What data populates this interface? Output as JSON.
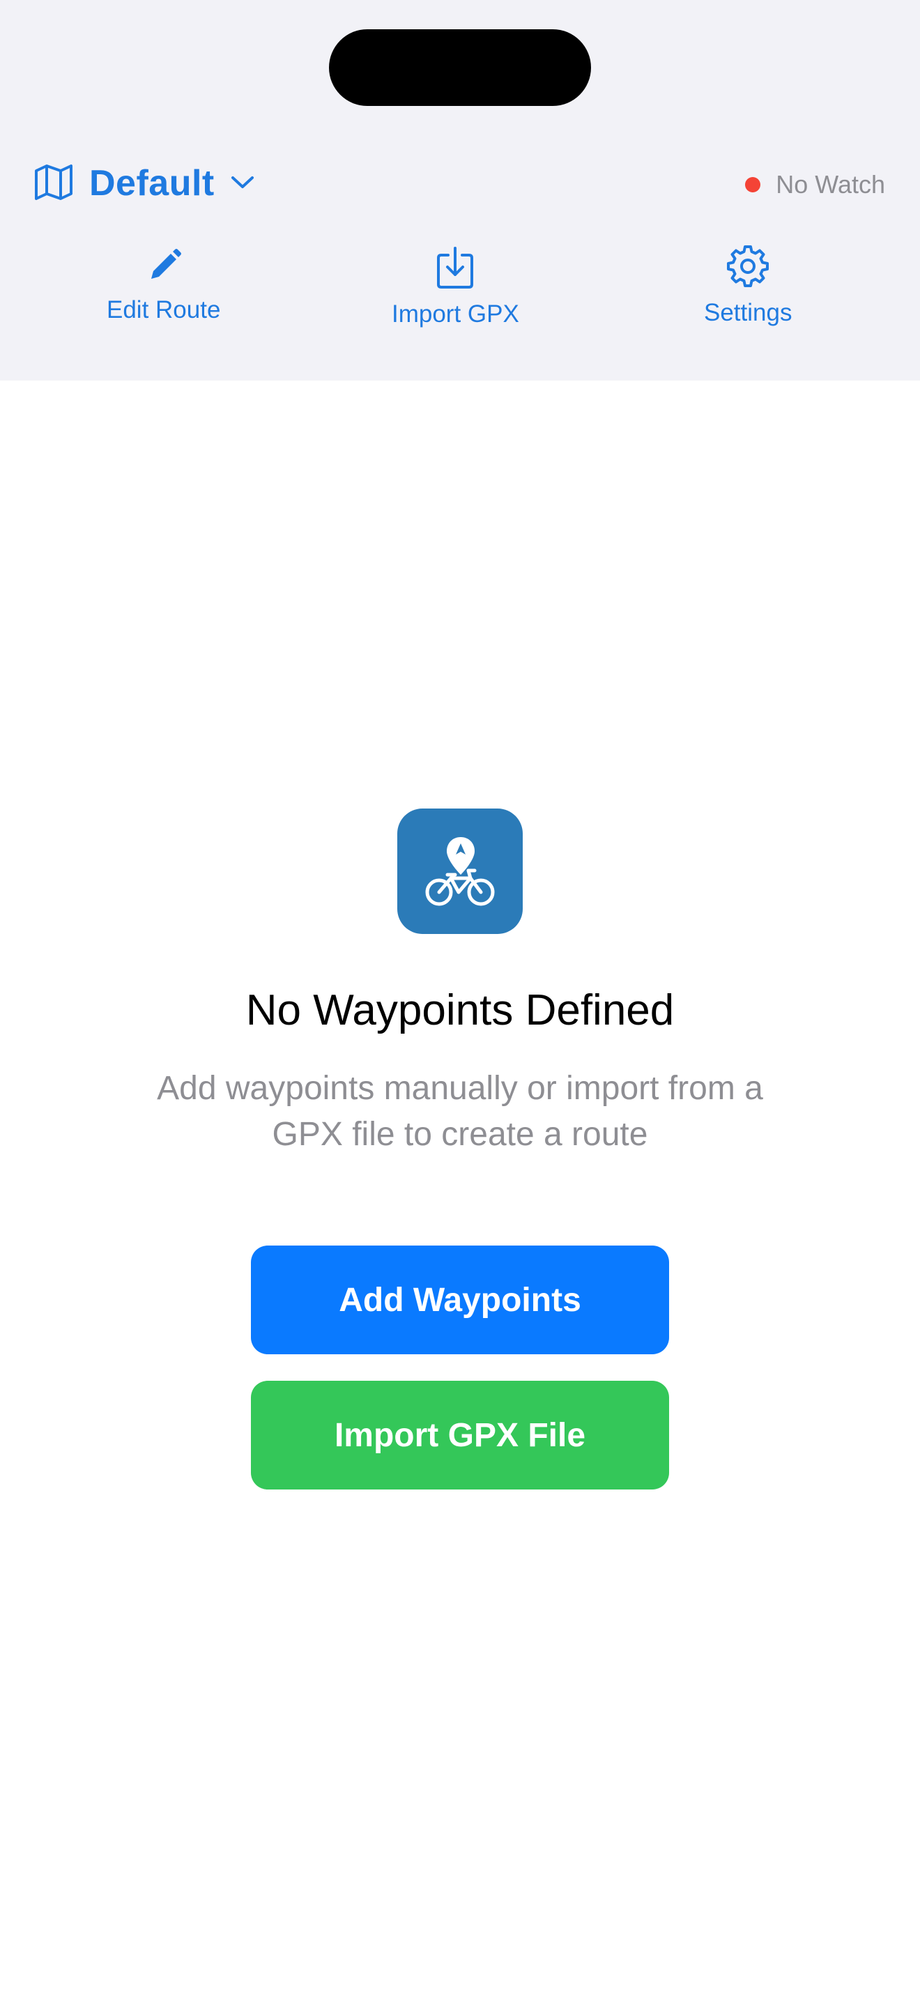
{
  "header": {
    "route_name": "Default",
    "watch_status": "No Watch",
    "toolbar": {
      "edit_route": "Edit Route",
      "import_gpx": "Import GPX",
      "settings": "Settings"
    }
  },
  "empty_state": {
    "title": "No Waypoints Defined",
    "description": "Add waypoints manually or import from a GPX file to create a route",
    "add_waypoints_button": "Add Waypoints",
    "import_gpx_file_button": "Import GPX File"
  },
  "colors": {
    "accent": "#1f7ae0",
    "background_header": "#f2f2f7",
    "status_dot": "#f44336",
    "primary_button": "#0a7aff",
    "secondary_button": "#34c759",
    "app_icon": "#2b7bb8"
  },
  "icons": {
    "route_selector": "map-icon",
    "route_dropdown": "chevron-down-icon",
    "edit_route": "pencil-icon",
    "import_gpx": "download-tray-icon",
    "settings": "gear-icon",
    "app_icon": "bicycle-location-icon"
  }
}
